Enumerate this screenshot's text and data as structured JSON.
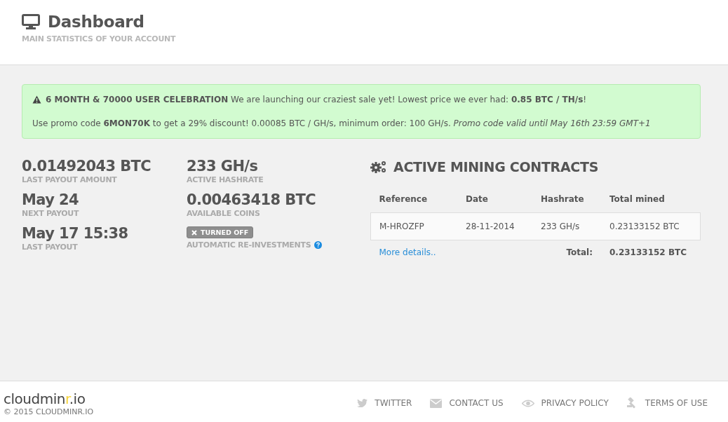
{
  "header": {
    "title": "Dashboard",
    "subtitle": "MAIN STATISTICS OF YOUR ACCOUNT"
  },
  "alert": {
    "lines": [
      "**6 MONTH & 70000 USER CELEBRATION** We are launching our craziest sale yet! Lowest price we ever had: **0.85 BTC / TH/s**!",
      "Use promo code **6MON70K** to get a 29% discount! 0.00085 BTC / GH/s, minimum order: 100 GH/s. *Promo code valid until May 16th 23:59 GMT+1*"
    ]
  },
  "stats": [
    {
      "value": "0.01492043 BTC",
      "label": "LAST PAYOUT AMOUNT"
    },
    {
      "value": "233 GH/s",
      "label": "ACTIVE HASHRATE"
    },
    {
      "value": "May 24",
      "label": "NEXT PAYOUT"
    },
    {
      "value": "0.00463418 BTC",
      "label": "AVAILABLE COINS"
    },
    {
      "value": "May 17 15:38",
      "label": "LAST PAYOUT"
    }
  ],
  "reinvest": {
    "on": false,
    "badge": "TURNED OFF",
    "label": "AUTOMATIC RE-INVESTMENTS"
  },
  "contracts": {
    "title": "ACTIVE MINING CONTRACTS",
    "columns": [
      "Reference",
      "Date",
      "Hashrate",
      "Total mined"
    ],
    "rows": [
      [
        "M-HROZFP",
        "28-11-2014",
        "233 GH/s",
        "0.23133152 BTC"
      ]
    ],
    "more_link": "More details..",
    "total_label": "Total:",
    "total_value": "0.23133152 BTC"
  },
  "footer": {
    "logo": {
      "before": "cloudmin",
      "accent": "r",
      "after": ".io"
    },
    "copyright": "© 2015 CLOUDMINR.IO",
    "links": [
      {
        "label": "TWITTER"
      },
      {
        "label": "CONTACT US"
      },
      {
        "label": "PRIVACY POLICY"
      },
      {
        "label": "TERMS OF USE"
      }
    ]
  }
}
